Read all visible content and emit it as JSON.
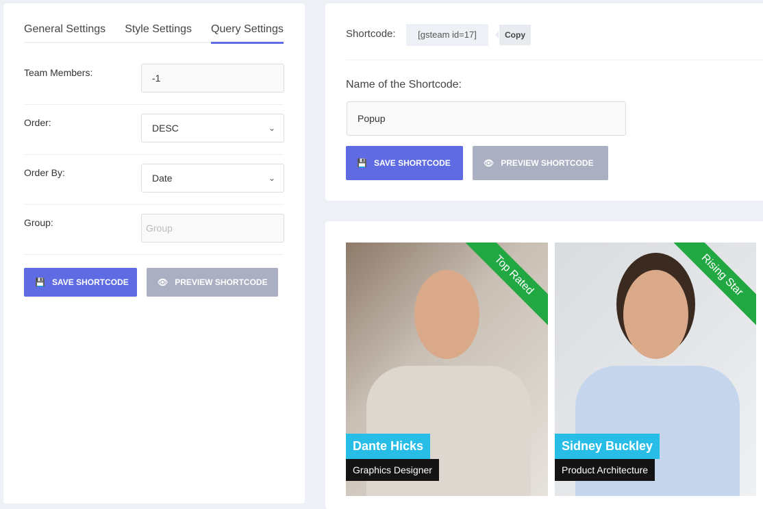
{
  "tabs": [
    "General Settings",
    "Style Settings",
    "Query Settings"
  ],
  "active_tab": "Query Settings",
  "query": {
    "team_members": {
      "label": "Team Members:",
      "value": "-1"
    },
    "order": {
      "label": "Order:",
      "value": "DESC"
    },
    "order_by": {
      "label": "Order By:",
      "value": "Date"
    },
    "group": {
      "label": "Group:",
      "placeholder": "Group"
    }
  },
  "buttons": {
    "save": "SAVE SHORTCODE",
    "preview": "PREVIEW SHORTCODE"
  },
  "shortcode": {
    "label": "Shortcode:",
    "code": "[gsteam id=17]",
    "copy": "Copy",
    "name_label": "Name of the Shortcode:",
    "name_value": "Popup"
  },
  "members": [
    {
      "name": "Dante Hicks",
      "designation": "Graphics Designer",
      "ribbon": "Top Rated"
    },
    {
      "name": "Sidney Buckley",
      "designation": "Product Architecture",
      "ribbon": "Rising Star"
    }
  ],
  "colors": {
    "accent": "#5f6be3",
    "ribbon": "#21a843",
    "name_bg": "#28bde6"
  }
}
